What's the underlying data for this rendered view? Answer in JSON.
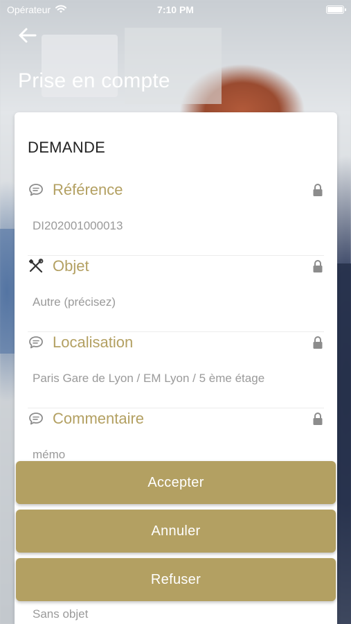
{
  "status_bar": {
    "carrier": "Opérateur",
    "time": "7:10 PM"
  },
  "header": {
    "title": "Prise en compte",
    "back_icon": "arrow-left-icon"
  },
  "card": {
    "section_title": "DEMANDE",
    "fields": [
      {
        "icon": "chat-bubble-icon",
        "label": "Référence",
        "value": "DI202001000013",
        "locked": true
      },
      {
        "icon": "tools-icon",
        "label": "Objet",
        "value": "Autre (précisez)",
        "locked": true
      },
      {
        "icon": "chat-bubble-icon",
        "label": "Localisation",
        "value": "Paris Gare de Lyon / EM Lyon / 5 ème étage",
        "locked": true
      },
      {
        "icon": "chat-bubble-icon",
        "label": "Commentaire",
        "value": "mémo",
        "locked": true
      }
    ],
    "bottom_value": "Sans objet"
  },
  "actions": {
    "accept": "Accepter",
    "cancel": "Annuler",
    "refuse": "Refuser"
  },
  "colors": {
    "accent": "#b3a062",
    "value_text": "#9a9a9a"
  }
}
